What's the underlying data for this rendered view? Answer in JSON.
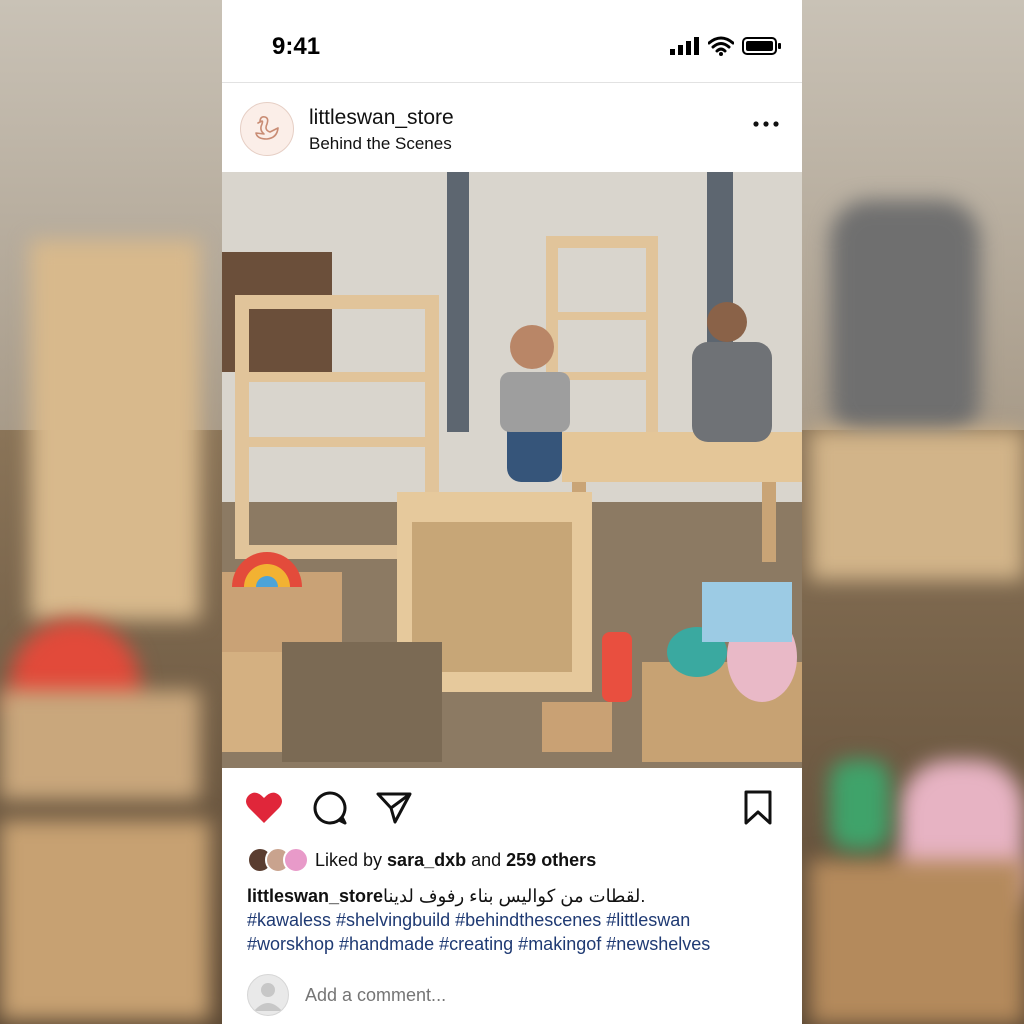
{
  "status_bar": {
    "time": "9:41"
  },
  "post": {
    "username": "littleswan_store",
    "subtitle": "Behind the Scenes",
    "image_alt": ""
  },
  "likes": {
    "prefix": "Liked by ",
    "user": "sara_dxb",
    "middle": " and ",
    "others": "259 others"
  },
  "caption": {
    "username": "littleswan_store",
    "text": "لقطات من كواليس بناء رفوف لدينا.",
    "hashtags_line1": "#kawaless #shelvingbuild #behindthescenes #littleswan",
    "hashtags_line2": "#worskhop #handmade #creating #makingof #newshelves"
  },
  "comment": {
    "placeholder": "Add a comment..."
  },
  "colors": {
    "like": "#e0263a",
    "hashtag": "#1f3a73",
    "text": "#111111"
  },
  "icons": [
    "signal-icon",
    "wifi-icon",
    "battery-icon",
    "more-icon",
    "heart-icon",
    "comment-icon",
    "share-icon",
    "bookmark-icon"
  ]
}
